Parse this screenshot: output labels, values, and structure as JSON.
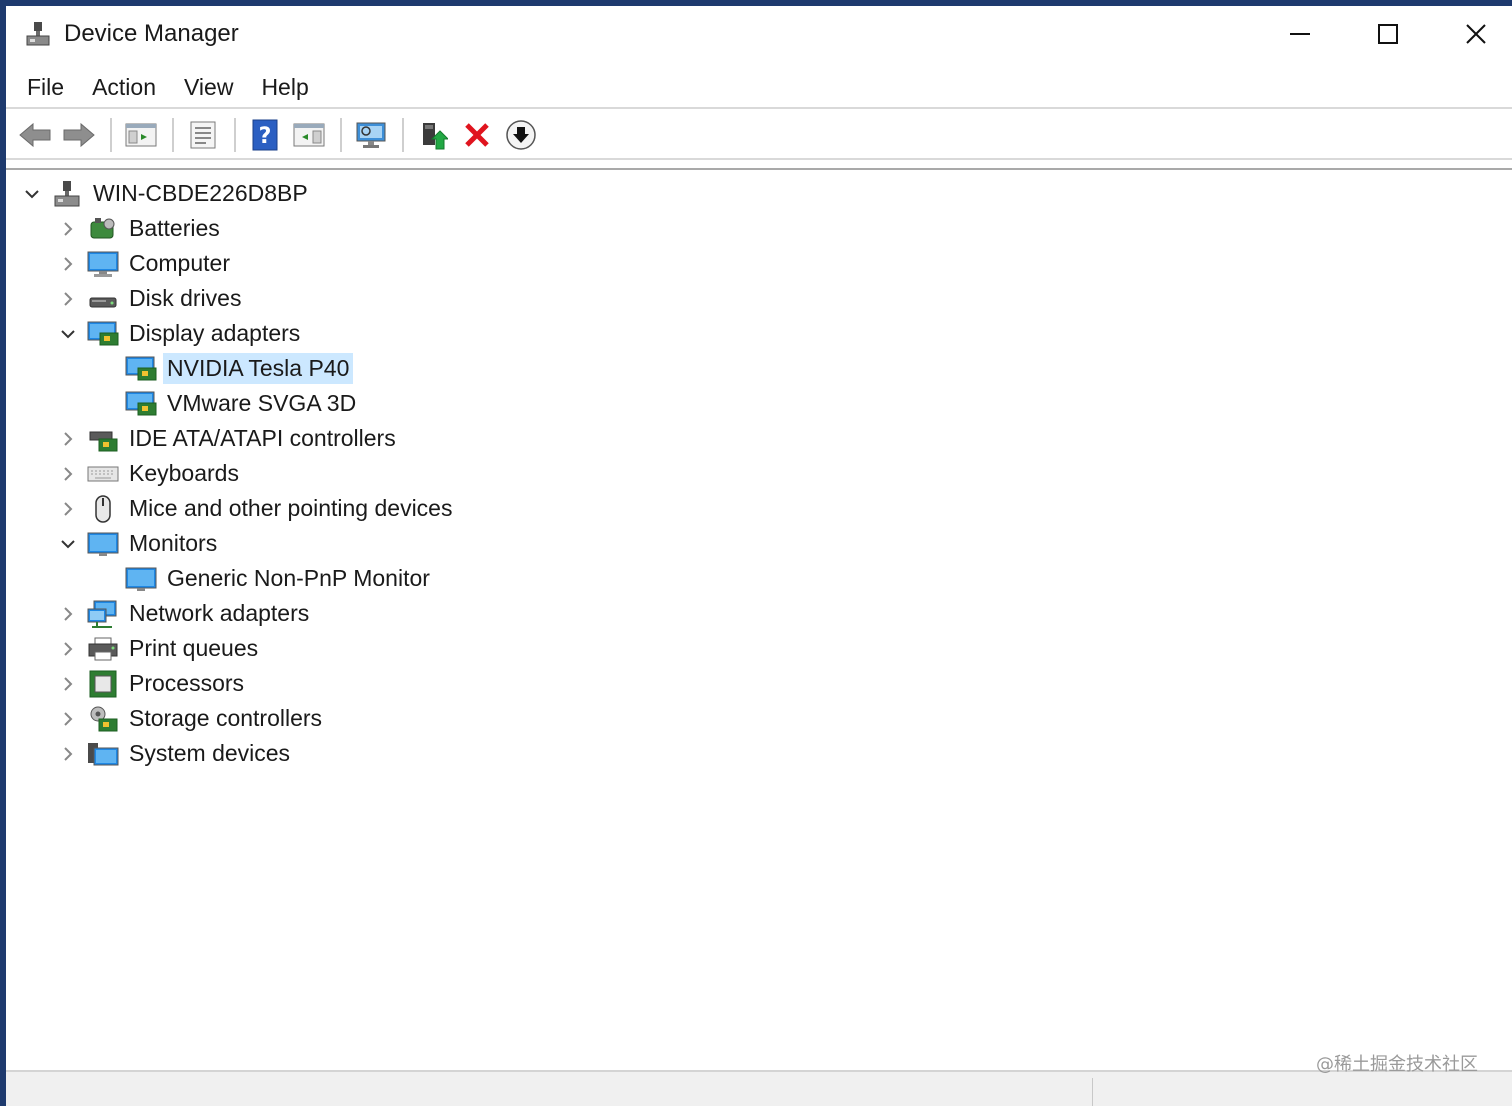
{
  "window": {
    "title": "Device Manager"
  },
  "menu": [
    "File",
    "Action",
    "View",
    "Help"
  ],
  "toolbar": {
    "buttons": [
      {
        "icon": "back-arrow-icon"
      },
      {
        "icon": "forward-arrow-icon"
      },
      {
        "icon": "show-hide-console-tree-icon"
      },
      {
        "icon": "properties-icon"
      },
      {
        "icon": "help-icon"
      },
      {
        "icon": "action-pane-icon"
      },
      {
        "icon": "scan-hardware-icon"
      },
      {
        "icon": "update-driver-icon"
      },
      {
        "icon": "uninstall-device-icon"
      },
      {
        "icon": "disable-device-icon"
      }
    ]
  },
  "tree": {
    "root": "WIN-CBDE226D8BP",
    "nodes": [
      {
        "label": "Batteries",
        "icon": "battery-icon",
        "expanded": false
      },
      {
        "label": "Computer",
        "icon": "computer-icon",
        "expanded": false
      },
      {
        "label": "Disk drives",
        "icon": "disk-drive-icon",
        "expanded": false
      },
      {
        "label": "Display adapters",
        "icon": "display-adapter-icon",
        "expanded": true,
        "children": [
          {
            "label": "NVIDIA Tesla P40",
            "icon": "display-adapter-icon",
            "selected": true
          },
          {
            "label": "VMware SVGA 3D",
            "icon": "display-adapter-icon"
          }
        ]
      },
      {
        "label": "IDE ATA/ATAPI controllers",
        "icon": "ide-controller-icon",
        "expanded": false
      },
      {
        "label": "Keyboards",
        "icon": "keyboard-icon",
        "expanded": false
      },
      {
        "label": "Mice and other pointing devices",
        "icon": "mouse-icon",
        "expanded": false
      },
      {
        "label": "Monitors",
        "icon": "monitor-icon",
        "expanded": true,
        "children": [
          {
            "label": "Generic Non-PnP Monitor",
            "icon": "monitor-icon"
          }
        ]
      },
      {
        "label": "Network adapters",
        "icon": "network-adapter-icon",
        "expanded": false
      },
      {
        "label": "Print queues",
        "icon": "printer-icon",
        "expanded": false
      },
      {
        "label": "Processors",
        "icon": "processor-icon",
        "expanded": false
      },
      {
        "label": "Storage controllers",
        "icon": "storage-controller-icon",
        "expanded": false
      },
      {
        "label": "System devices",
        "icon": "system-devices-icon",
        "expanded": false
      }
    ]
  },
  "watermark": "@稀土掘金技术社区",
  "colors": {
    "selection": "#cce8ff",
    "desktop": "#1e3a6e"
  }
}
